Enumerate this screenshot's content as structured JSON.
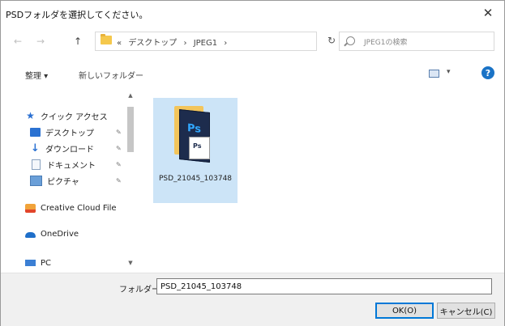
{
  "window": {
    "title": "PSDフォルダを選択してください。",
    "close_glyph": "✕"
  },
  "nav": {
    "back_glyph": "←",
    "forward_glyph": "→",
    "up_glyph": "↑",
    "breadcrumb": [
      "«",
      "デスクトップ",
      "›",
      "JPEG1",
      "›"
    ],
    "dropdown_glyph": "⌄",
    "refresh_glyph": "↻",
    "search_placeholder": "JPEG1の検索"
  },
  "toolbar": {
    "organize_label": "整理 ▾",
    "new_folder_label": "新しいフォルダー",
    "view_caret": "▾",
    "help_label": "?"
  },
  "sidebar": {
    "items": [
      {
        "label": "クイック アクセス",
        "icon": "star-icon",
        "pinned": false
      },
      {
        "label": "デスクトップ",
        "icon": "desktop-icon",
        "pinned": true
      },
      {
        "label": "ダウンロード",
        "icon": "download-icon",
        "pinned": true
      },
      {
        "label": "ドキュメント",
        "icon": "documents-icon",
        "pinned": true
      },
      {
        "label": "ピクチャ",
        "icon": "pictures-icon",
        "pinned": true
      },
      {
        "label": "Creative Cloud File",
        "icon": "creative-cloud-icon",
        "pinned": false
      },
      {
        "label": "OneDrive",
        "icon": "onedrive-icon",
        "pinned": false
      },
      {
        "label": "PC",
        "icon": "pc-icon",
        "pinned": false
      }
    ],
    "pin_glyph": "✎",
    "scroll_up": "▲",
    "scroll_down": "▼"
  },
  "content": {
    "files": [
      {
        "name": "PSD_21045_103748",
        "icon": "psd-folder-icon",
        "selected": true,
        "ps_label": "Ps"
      }
    ]
  },
  "footer": {
    "folder_label": "フォルダー:",
    "folder_value": "PSD_21045_103748",
    "ok_label": "OK(O)",
    "cancel_label": "キャンセル(C)"
  }
}
